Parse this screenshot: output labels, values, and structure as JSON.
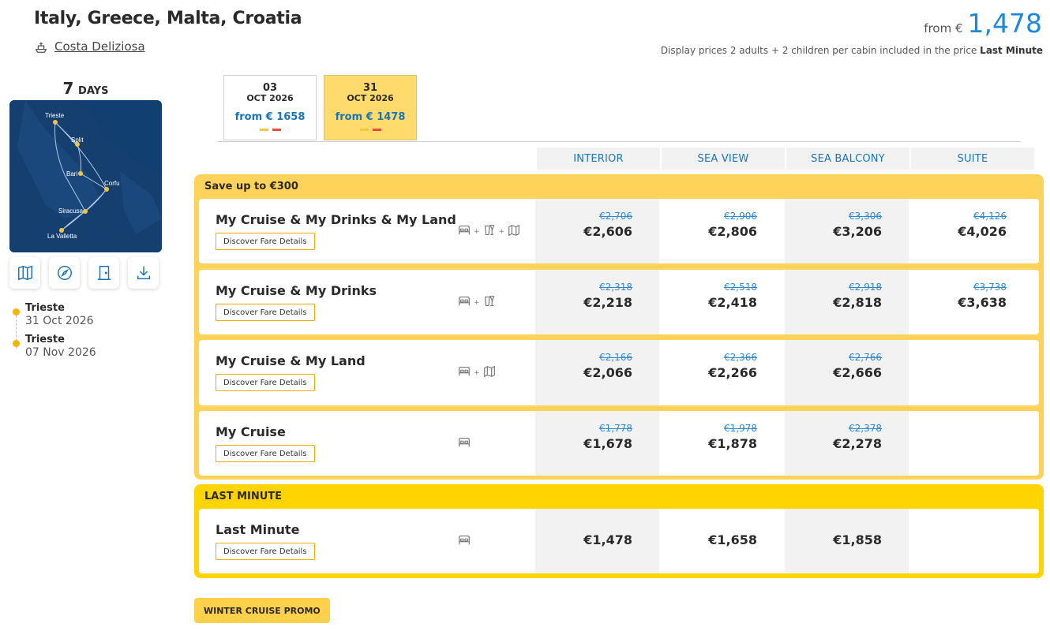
{
  "header": {
    "title": "Italy, Greece, Malta, Croatia",
    "ship": "Costa Deliziosa",
    "from_label": "from €",
    "from_price": "1,478",
    "display_note": "Display prices 2 adults + 2 children per cabin included in the price",
    "display_note_bold": "Last Minute"
  },
  "sidebar": {
    "days_num": "7",
    "days_unit": "DAYS",
    "map_ports": [
      "Trieste",
      "Split",
      "Bari",
      "Corfu",
      "Siracusa",
      "La Valletta"
    ],
    "actions": [
      {
        "name": "map-icon"
      },
      {
        "name": "compass-icon"
      },
      {
        "name": "door-icon"
      },
      {
        "name": "download-icon"
      }
    ],
    "itinerary": [
      {
        "port": "Trieste",
        "date": "31 Oct 2026"
      },
      {
        "port": "Trieste",
        "date": "07 Nov 2026"
      }
    ]
  },
  "dates": [
    {
      "day": "03",
      "month": "OCT 2026",
      "price": "from € 1658",
      "selected": false
    },
    {
      "day": "31",
      "month": "OCT 2026",
      "price": "from € 1478",
      "selected": true
    }
  ],
  "columns": [
    "INTERIOR",
    "SEA VIEW",
    "SEA BALCONY",
    "SUITE"
  ],
  "groups": [
    {
      "label": "Save up to €300",
      "rows": [
        {
          "name": "My Cruise & My Drinks & My Land",
          "cta": "Discover Fare Details",
          "icons": [
            "bed-icon",
            "drink-icon",
            "map-icon"
          ],
          "prices": [
            {
              "old": "€2,706",
              "new": "€2,606"
            },
            {
              "old": "€2,906",
              "new": "€2,806"
            },
            {
              "old": "€3,306",
              "new": "€3,206"
            },
            {
              "old": "€4,126",
              "new": "€4,026"
            }
          ]
        },
        {
          "name": "My Cruise & My Drinks",
          "cta": "Discover Fare Details",
          "icons": [
            "bed-icon",
            "drink-icon"
          ],
          "prices": [
            {
              "old": "€2,318",
              "new": "€2,218"
            },
            {
              "old": "€2,518",
              "new": "€2,418"
            },
            {
              "old": "€2,918",
              "new": "€2,818"
            },
            {
              "old": "€3,738",
              "new": "€3,638"
            }
          ]
        },
        {
          "name": "My Cruise & My Land",
          "cta": "Discover Fare Details",
          "icons": [
            "bed-icon",
            "map-icon"
          ],
          "prices": [
            {
              "old": "€2,166",
              "new": "€2,066"
            },
            {
              "old": "€2,366",
              "new": "€2,266"
            },
            {
              "old": "€2,766",
              "new": "€2,666"
            },
            null
          ]
        },
        {
          "name": "My Cruise",
          "cta": "Discover Fare Details",
          "icons": [
            "bed-icon"
          ],
          "prices": [
            {
              "old": "€1,778",
              "new": "€1,678"
            },
            {
              "old": "€1,978",
              "new": "€1,878"
            },
            {
              "old": "€2,378",
              "new": "€2,278"
            },
            null
          ]
        }
      ]
    },
    {
      "label": "LAST MINUTE",
      "rows": [
        {
          "name": "Last Minute",
          "cta": "Discover Fare Details",
          "icons": [
            "bed-icon"
          ],
          "prices": [
            {
              "old": "",
              "new": "€1,478"
            },
            {
              "old": "",
              "new": "€1,658"
            },
            {
              "old": "",
              "new": "€1,858"
            },
            null
          ]
        }
      ]
    }
  ],
  "promo": "WINTER CRUISE PROMO",
  "colors": {
    "accent_blue": "#1e88d8",
    "panel_yellow_save": "#ffd25a",
    "panel_yellow_last": "#ffd400",
    "bar_yellow": "#f4c542",
    "bar_red": "#e84a3c"
  }
}
